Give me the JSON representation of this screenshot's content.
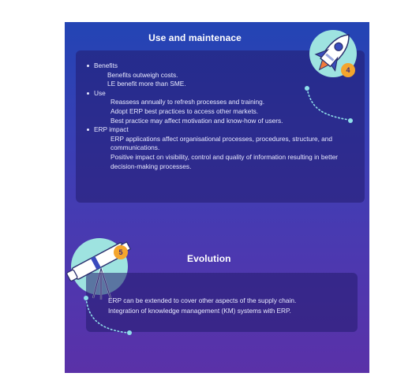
{
  "section1": {
    "title": "Use and maintenace",
    "badge": "4",
    "items": [
      {
        "label": "Benefits",
        "lines": [
          "Benefits outweigh costs.",
          "LE benefit more than SME."
        ]
      },
      {
        "label": "Use",
        "lines": [
          "Reassess annually to refresh processes and training.",
          "Adopt ERP best practices to access other markets.",
          "Best practice may affect motivation and know-how of users."
        ]
      },
      {
        "label": "ERP impact",
        "lines": [
          "ERP applications affect organisational processes, procedures, structure, and communications.",
          "Positive impact on visibility, control and quality of information resulting in better decision-making processes."
        ]
      }
    ]
  },
  "section2": {
    "title": "Evolution",
    "badge": "5",
    "lines": [
      "ERP can be extended to cover other aspects of the supply chain.",
      "Integration of knowledge management (KM) systems with ERP."
    ]
  },
  "colors": {
    "background_top": "#2344b4",
    "background_bottom": "#5a31a8",
    "badge": "#f4a52d",
    "illustration_circle": "#9ee3e0"
  }
}
